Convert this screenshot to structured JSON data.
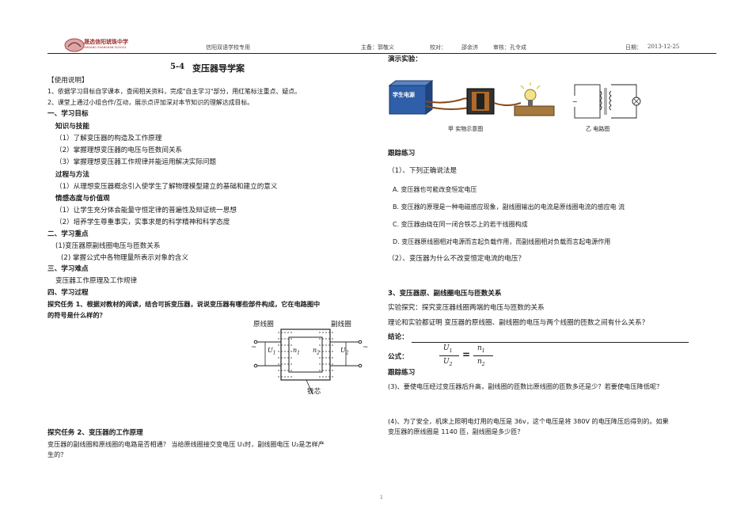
{
  "header": {
    "school_name": "晟选信阳琥珠中学",
    "school_name_en": "XINYANG SHANSHAN SCHOOL",
    "banner": "信阳双语学校专用",
    "author": "主备：郭敬义",
    "proofreader": "校对：",
    "proofreader_name": "邵余济",
    "reviewer": "审核：孔令成",
    "date_label": "日期：",
    "date_value": "2013-12-25"
  },
  "left": {
    "title_num": "5-4",
    "title_text": "变压器导学案",
    "usage_heading": "【使用说明】",
    "usage_1": "1、依据学习目标自学课本，查阅相关资料，完成\"自主学习\"部分，用红笔标注重点、疑点。",
    "usage_2": "2、课堂上通过小组合作/互动，展示点评加深对本节知识的理解达成目标。",
    "sec1": "一、学习目标",
    "sub_knowledge": "知识与技能",
    "k1": "（1）了解变压器的构造及工作原理",
    "k2": "（2）掌握理想变压器的电压与匝数间关系",
    "k3": "（3）掌握理想变压器工作规律并能运用解决实际问题",
    "sub_process": "过程与方法",
    "p1": "（1）从理想变压器概念引入使学生了解物理模型建立的基础和建立的意义",
    "sub_emotion": "情感态度与价值观",
    "e1": "（1）让学生充分体会能量守恒定律的普遍性及辩证统一思想",
    "e2": "（2）培养学生尊重事实，实事求是的科学精神和科学态度",
    "sec2": "二、学习重点",
    "f1": "(1)变压器原副线圈电压与匝数关系",
    "f2": "(2)  掌握公式中各物理量所表示对象的含义",
    "sec3": "三、学习难点",
    "d1": "变压器工作原理及工作规律",
    "sec4": "四、学习过程",
    "task1_line1": "探究任务 1、根据对教材的阅读，结合可拆变压器，说说变压器有哪些部件构成，它在电路图中",
    "task1_line2": "的符号是什么样的？",
    "fig_primary": "原线圈",
    "fig_secondary": "副线圈",
    "fig_core": "铁芯",
    "fig_u1": "U",
    "fig_u1_sub": "1",
    "fig_n1": "n",
    "fig_n1_sub": "1",
    "fig_n2": "n",
    "fig_n2_sub": "2",
    "fig_u2": "U",
    "fig_u2_sub": "2",
    "fig_ac": "~",
    "task2_title": "探究任务 2、变压器的工作原理",
    "task2_line1": "变压器的副线圈和原线圈的电路是否相通？ 当给原线圈接交变电压  U₁时，副线圈电压 U₂是怎样产",
    "task2_line2": "生的？"
  },
  "right": {
    "demo_title": "演示实验：",
    "power_label": "学生电源",
    "caption_a": "甲  实物示意图",
    "caption_b": "乙  电路图",
    "follow1": "跟踪练习",
    "q1": "（1）、下列正确说法是",
    "optA": "A.  变压器也可能改变恒定电压",
    "optB": "B.  变压器的原理是一种电磁感应现象，副线圈输出的电流是原线圈电流的感应电  流",
    "optC": "C.  变压器由绕在同一闭合铁芯上的若干线圈构成",
    "optD": "D.  变压器原线圈相对电源而言起负载作用，而副线圈相对负载而言起电源作用",
    "q2": "（2）、变压器为什么不改变恒定电流的电压？",
    "sec3_title": "3、变压器原、副线圈电压与匝数关系",
    "explore": "实验探究：探究变压器线圈两端的电压与匝数的关系",
    "theory": "理论和实验都证明  变压器的原线圈、副线圈的电压与两个线圈的匝数之间有什么关系？",
    "conclusion": "结论：",
    "formula_label": "公式：",
    "f_u1": "U",
    "f_u1_sub": "1",
    "f_u2": "U",
    "f_u2_sub": "2",
    "f_n1": "n",
    "f_n1_sub": "1",
    "f_n2": "n",
    "f_n2_sub": "2",
    "f_eq": "=",
    "follow2": "跟踪练习",
    "q3": "(3)、要使电压经过变压器后升高，副线圈的匝数比原线圈的匝数多还是少？若要使电压降低呢？",
    "q4_line1": "(4)、为了安全，机床上照明电灯用的电压是  36v，这个电压是将 380V 的电压降压后得到的。如果",
    "q4_line2": "变压器的原线圈是 1140 匝，副线圈是多少匝？"
  },
  "footer": {
    "page_number": "1"
  }
}
